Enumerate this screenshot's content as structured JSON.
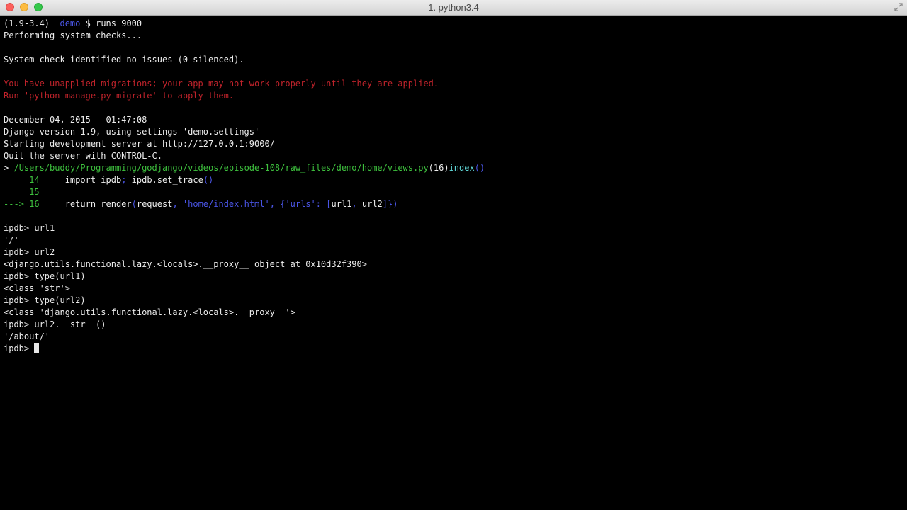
{
  "window": {
    "title": "1. python3.4"
  },
  "terminal": {
    "prompt": {
      "env": "(1.9-3.4)",
      "dir": "demo",
      "dollar": "$",
      "command": "runs 9000"
    },
    "line_checks": "Performing system checks...",
    "line_issues": "System check identified no issues (0 silenced).",
    "warn_1": "You have unapplied migrations; your app may not work properly until they are applied.",
    "warn_2": "Run 'python manage.py migrate' to apply them.",
    "date": "December 04, 2015 - 01:47:08",
    "django_version": "Django version 1.9, using settings 'demo.settings'",
    "dev_server": "Starting development server at http://127.0.0.1:9000/",
    "quit": "Quit the server with CONTROL-C.",
    "trace": {
      "arrow": ">",
      "path": "/Users/buddy/Programming/godjango/videos/episode-108/raw_files/demo/home/views.py",
      "lineno": "(16)",
      "func": "index",
      "parens": "()"
    },
    "code": {
      "l14_num": "14",
      "l14_import": "import ipdb",
      "l14_sep": ";",
      "l14_call": "ipdb.set_trace",
      "l14_parens": "()",
      "l15_num": "15",
      "l16_arrow": "---> 16",
      "l16_return": "return render",
      "l16_open": "(",
      "l16_request": "request",
      "l16_comma1": ",",
      "l16_template": "'home/index.html'",
      "l16_comma2": ",",
      "l16_dict_open": "{",
      "l16_key": "'urls'",
      "l16_colon": ":",
      "l16_list_open": "[",
      "l16_url1": "url1",
      "l16_comma3": ",",
      "l16_url2": "url2",
      "l16_close": "]})"
    },
    "session": [
      "ipdb> url1",
      "'/'",
      "ipdb> url2",
      "<django.utils.functional.lazy.<locals>.__proxy__ object at 0x10d32f390>",
      "ipdb> type(url1)",
      "<class 'str'>",
      "ipdb> type(url2)",
      "<class 'django.utils.functional.lazy.<locals>.__proxy__'>",
      "ipdb> url2.__str__()",
      "'/about/'"
    ],
    "current_prompt": "ipdb> "
  },
  "colors": {
    "background": "#000000",
    "foreground": "#ececec",
    "error_red": "#c0232b",
    "cyan": "#5fd7d7",
    "green": "#3ec13e",
    "blue": "#4a55e6"
  }
}
